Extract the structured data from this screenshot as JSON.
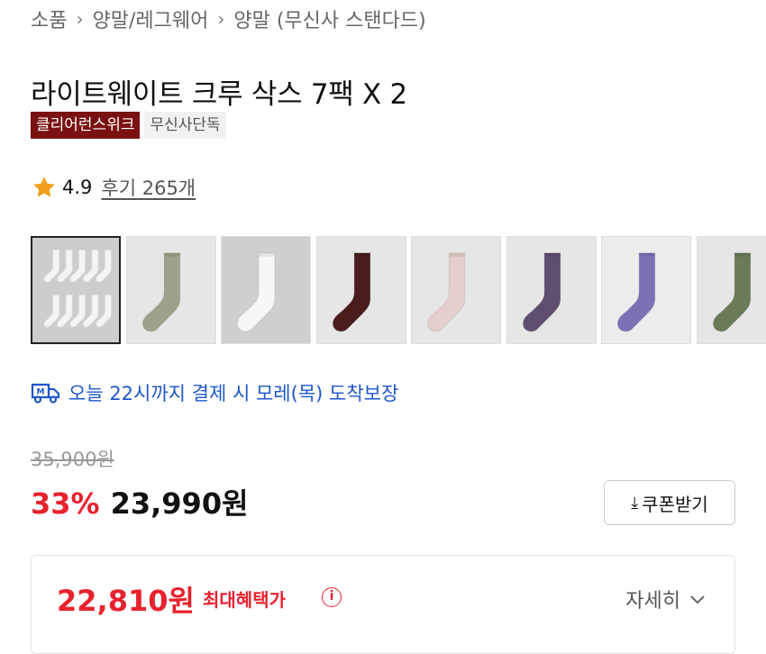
{
  "breadcrumb": [
    "소품",
    "양말/레그웨어",
    "양말 (무신사 스탠다드)"
  ],
  "product": {
    "title": "라이트웨이트 크루 삭스 7팩 X 2",
    "badges": [
      "클리어런스위크",
      "무신사단독"
    ]
  },
  "rating": {
    "icon": "star-icon",
    "score": "4.9",
    "reviews": "후기 265개"
  },
  "thumbnails": [
    {
      "name": "white-7pack",
      "color": "#f4f4f4",
      "bg": "#cdcdcd",
      "multi": true
    },
    {
      "name": "sage",
      "color": "#9ea08a",
      "bg": "#e6e6e6"
    },
    {
      "name": "white",
      "color": "#f7f7f7",
      "bg": "#cfcfcf"
    },
    {
      "name": "burgundy",
      "color": "#4a1c1c",
      "bg": "#e6e6e6"
    },
    {
      "name": "pink",
      "color": "#e3cfcc",
      "bg": "#e6e6e6"
    },
    {
      "name": "purple",
      "color": "#5f4e6e",
      "bg": "#e6e6e6"
    },
    {
      "name": "lavender",
      "color": "#7b72b6",
      "bg": "#ececec"
    },
    {
      "name": "olive",
      "color": "#6b7a58",
      "bg": "#e6e6e6"
    }
  ],
  "delivery": {
    "icon": "delivery-truck-icon",
    "text": "오늘 22시까지 결제 시 모레(목) 도착보장"
  },
  "price": {
    "original": "35,900원",
    "discount": "33%",
    "sale": "23,990원",
    "coupon_label": "쿠폰받기",
    "coupon_icon": "download-icon"
  },
  "benefit": {
    "price": "22,810원",
    "label": "최대혜택가",
    "info_icon": "info-icon",
    "details_label": "자세히",
    "chevron_icon": "chevron-down-icon"
  },
  "colors": {
    "accent_red": "#e8222e",
    "badge_brand": "#7a1111",
    "link_blue": "#1f56c8"
  }
}
